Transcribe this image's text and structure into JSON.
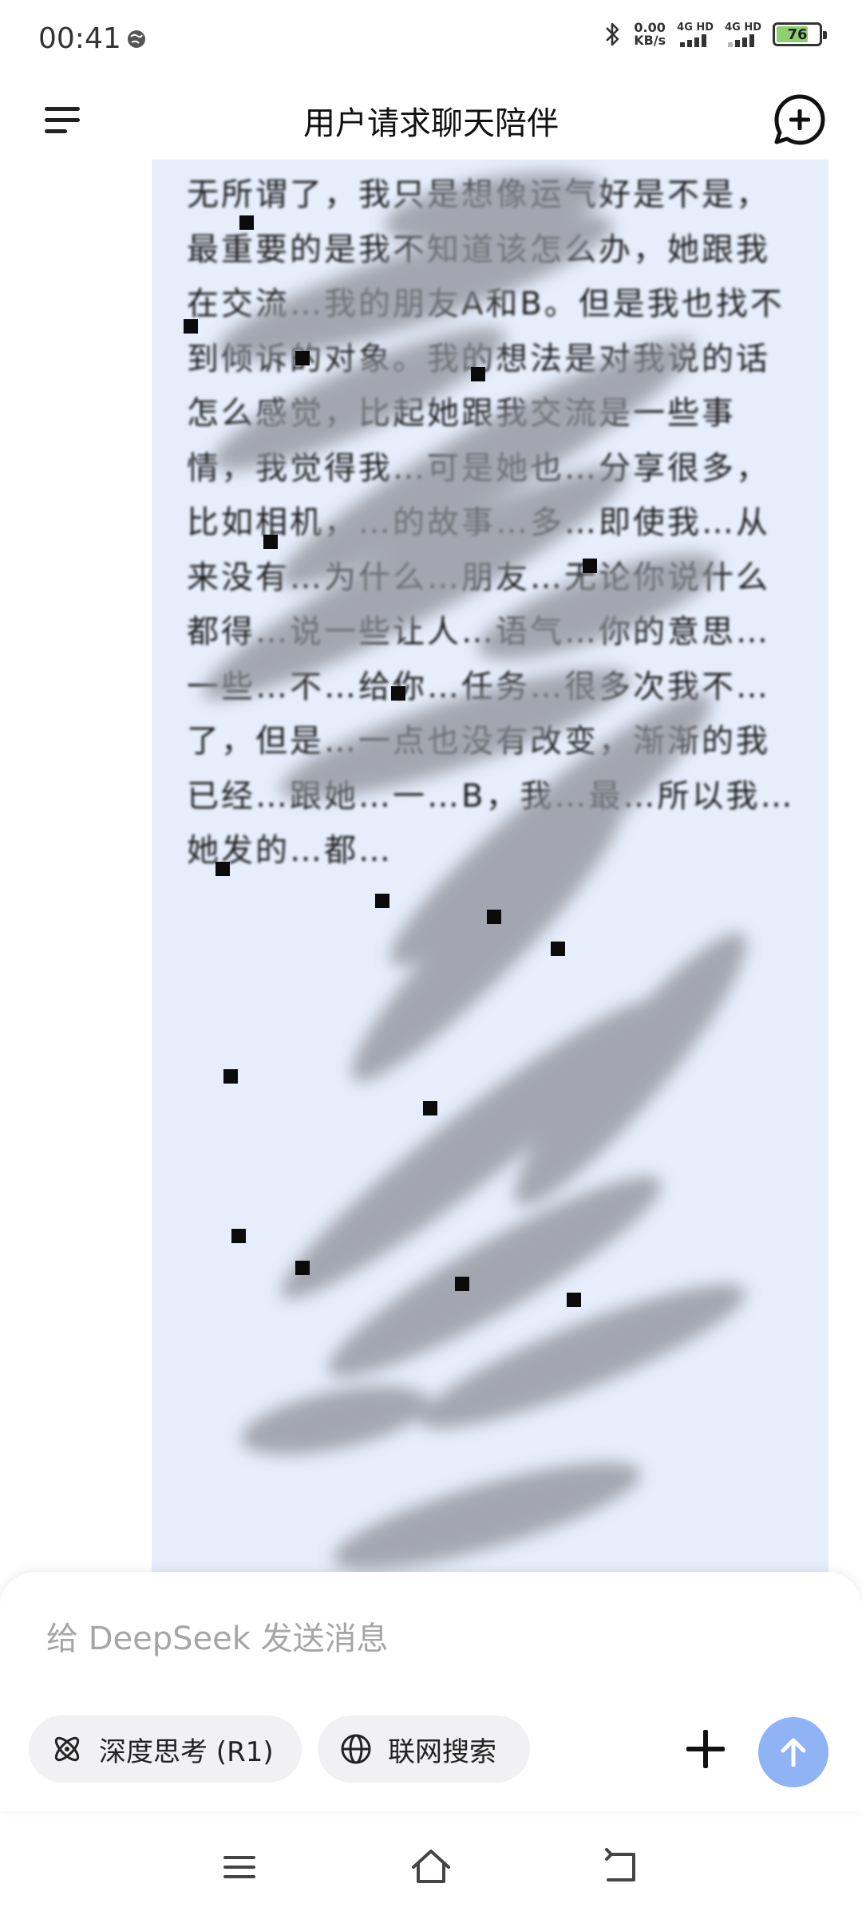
{
  "status_bar": {
    "time": "00:41",
    "net_speed_value": "0.00",
    "net_speed_unit": "KB/s",
    "sim1_label": "4G HD",
    "sim2_label": "4G HD",
    "battery_level": "76"
  },
  "header": {
    "title": "用户请求聊天陪伴"
  },
  "message": {
    "text": "无所谓了，我只是想像运气好是不是，最重要的是我不知道该怎么办，她跟我在交流…我的朋友A和B。但是我也找不到倾诉的对象。我的想法是对我说的话怎么感觉，比起她跟我交流是一些事情，我觉得我…可是她也…分享很多，比如相机，…的故事…多…即使我…从来没有…为什么…朋友…无论你说什么都得…说一些让人…语气…你的意思…一些…不…给你…任务…很多次我不…了，但是…一点也没有改变，渐渐的我已经…跟她…一…B，我…最…所以我…她发的…都…"
  },
  "composer": {
    "placeholder": "给 DeepSeek 发送消息",
    "deep_think_label": "深度思考 (R1)",
    "web_search_label": "联网搜索"
  },
  "colors": {
    "bubble_bg": "#e6eefc",
    "send_button": "#8fb3f5",
    "battery_fill": "#8fcf6f"
  },
  "icons": {
    "menu": "menu-icon",
    "new_chat": "new-chat-icon",
    "scroll_down": "arrow-down-icon",
    "deep_think": "atom-icon",
    "web_search": "globe-icon",
    "attach": "plus-icon",
    "send": "arrow-up-icon",
    "nav_recents": "recents-icon",
    "nav_home": "home-icon",
    "nav_back": "back-icon"
  }
}
